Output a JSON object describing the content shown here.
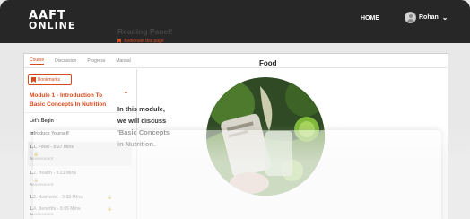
{
  "header": {
    "logo_line1": "AAFT",
    "logo_line2": "ONLINE",
    "nav_home": "HOME",
    "user_name": "Rohan",
    "user_chevron": "⌄"
  },
  "tabs": [
    {
      "label": "Course",
      "active": true
    },
    {
      "label": "Discussion",
      "active": false
    },
    {
      "label": "Progress",
      "active": false
    },
    {
      "label": "Manual",
      "active": false
    }
  ],
  "sidebar": {
    "bookmarks_label": "Bookmarks",
    "module_title": "Module 1 - Introduction To Basic Concepts In Nutrition",
    "module_chevron": "⌃",
    "items": [
      {
        "label": "Let's Begin"
      },
      {
        "label": "Introduce Yourself"
      }
    ],
    "lessons": [
      {
        "label": "1.1. Food - 5:27 Mins",
        "sub": "Assessment",
        "locked": true,
        "selected": true
      },
      {
        "label": "1.2. Health - 9:21 Mins",
        "sub": "Assessment",
        "locked": true,
        "selected": false
      },
      {
        "label": "1.3. Nutrients - 3:32 Mins",
        "sub": "",
        "locked": true,
        "selected": false
      },
      {
        "label": "1.4. Benefits - 5:05 Mins",
        "sub": "Assessment",
        "locked": true,
        "selected": false
      }
    ]
  },
  "main": {
    "reading_title": "Reading Panel!",
    "bookmark_page": "Bookmark this page",
    "section_title": "Food",
    "intro_line1": "In this module,",
    "intro_line2": "we will discuss",
    "intro_line3": "'Basic Concepts",
    "intro_line4": "in Nutrition."
  },
  "colors": {
    "accent": "#d74a1e",
    "topbar": "#272727"
  },
  "icons": {
    "bookmark": "bookmark-icon",
    "lock": "lock-icon",
    "avatar": "user-avatar-icon"
  }
}
